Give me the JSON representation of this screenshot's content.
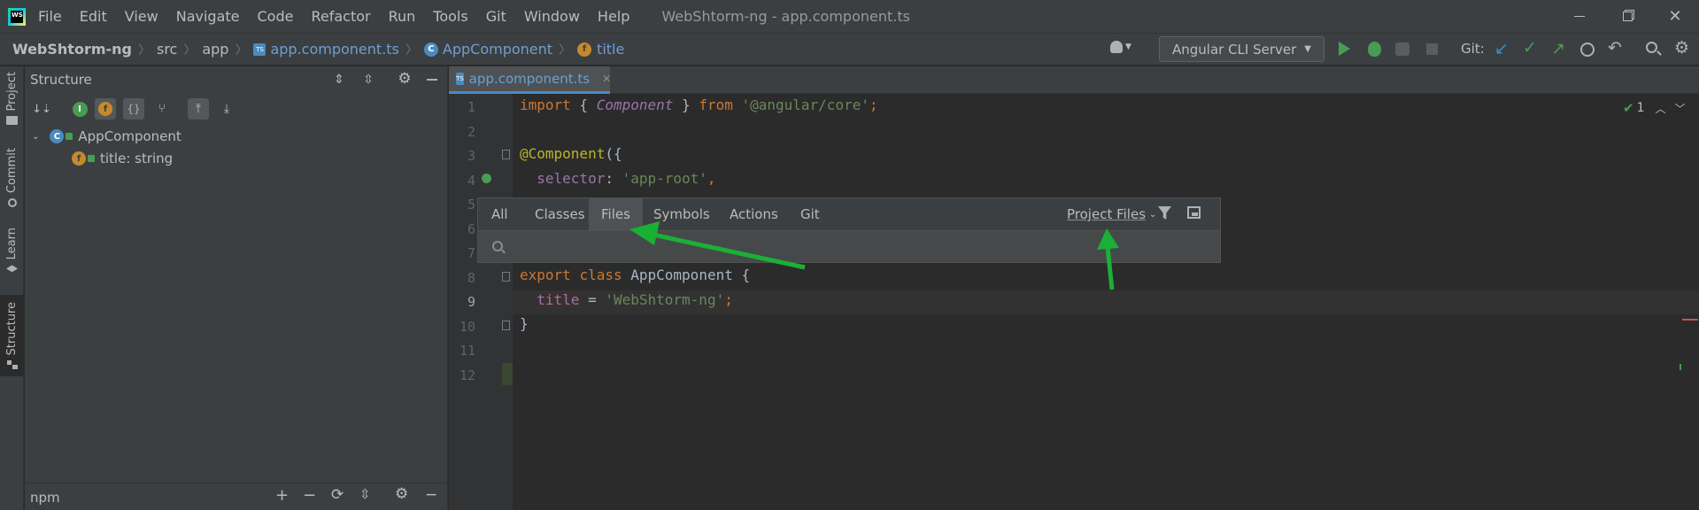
{
  "window": {
    "title": "WebShtorm-ng - app.component.ts",
    "menu": [
      "File",
      "Edit",
      "View",
      "Navigate",
      "Code",
      "Refactor",
      "Run",
      "Tools",
      "Git",
      "Window",
      "Help"
    ]
  },
  "navbar": {
    "breadcrumbs": [
      "WebShtorm-ng",
      "src",
      "app",
      "app.component.ts",
      "AppComponent",
      "title"
    ],
    "run_config": "Angular CLI Server",
    "git_label": "Git:"
  },
  "left_strip": {
    "tabs": [
      "Project",
      "Commit",
      "Learn",
      "Structure"
    ]
  },
  "structure_panel": {
    "title": "Structure",
    "tree": [
      {
        "label": "AppComponent",
        "icon": "class-icon"
      },
      {
        "label": "title: string",
        "icon": "field-icon"
      }
    ],
    "bottom_title": "npm"
  },
  "editor": {
    "tab_label": "app.component.ts",
    "inspection_count": "1",
    "line_numbers": [
      "1",
      "2",
      "3",
      "4",
      "5",
      "6",
      "7",
      "8",
      "9",
      "10",
      "11",
      "12"
    ],
    "code": {
      "l1_kw": "import",
      "l1_open": " { ",
      "l1_name": "Component",
      "l1_close": " } ",
      "l1_from": "from",
      "l1_str": " '@angular/core'",
      "l1_end": ";",
      "l3_ann": "@Component",
      "l3_rest": "({",
      "l4_prop": "selector",
      "l4_colon": ": ",
      "l4_str": "'app-root'",
      "l4_end": ",",
      "l8_kw1": "export",
      "l8_kw2": "class",
      "l8_name": "AppComponent {",
      "l9_prop": "title",
      "l9_eq": " = ",
      "l9_str": "'WebShtorm-ng'",
      "l9_end": ";",
      "l10": "}"
    }
  },
  "search_popup": {
    "tabs": [
      "All",
      "Classes",
      "Files",
      "Symbols",
      "Actions",
      "Git"
    ],
    "selected_tab": "Files",
    "scope": "Project Files",
    "search_value": ""
  },
  "colors": {
    "accent_green": "#1ab036",
    "keyword": "#cc7832",
    "string": "#6a8759",
    "annotation": "#bbb529"
  }
}
